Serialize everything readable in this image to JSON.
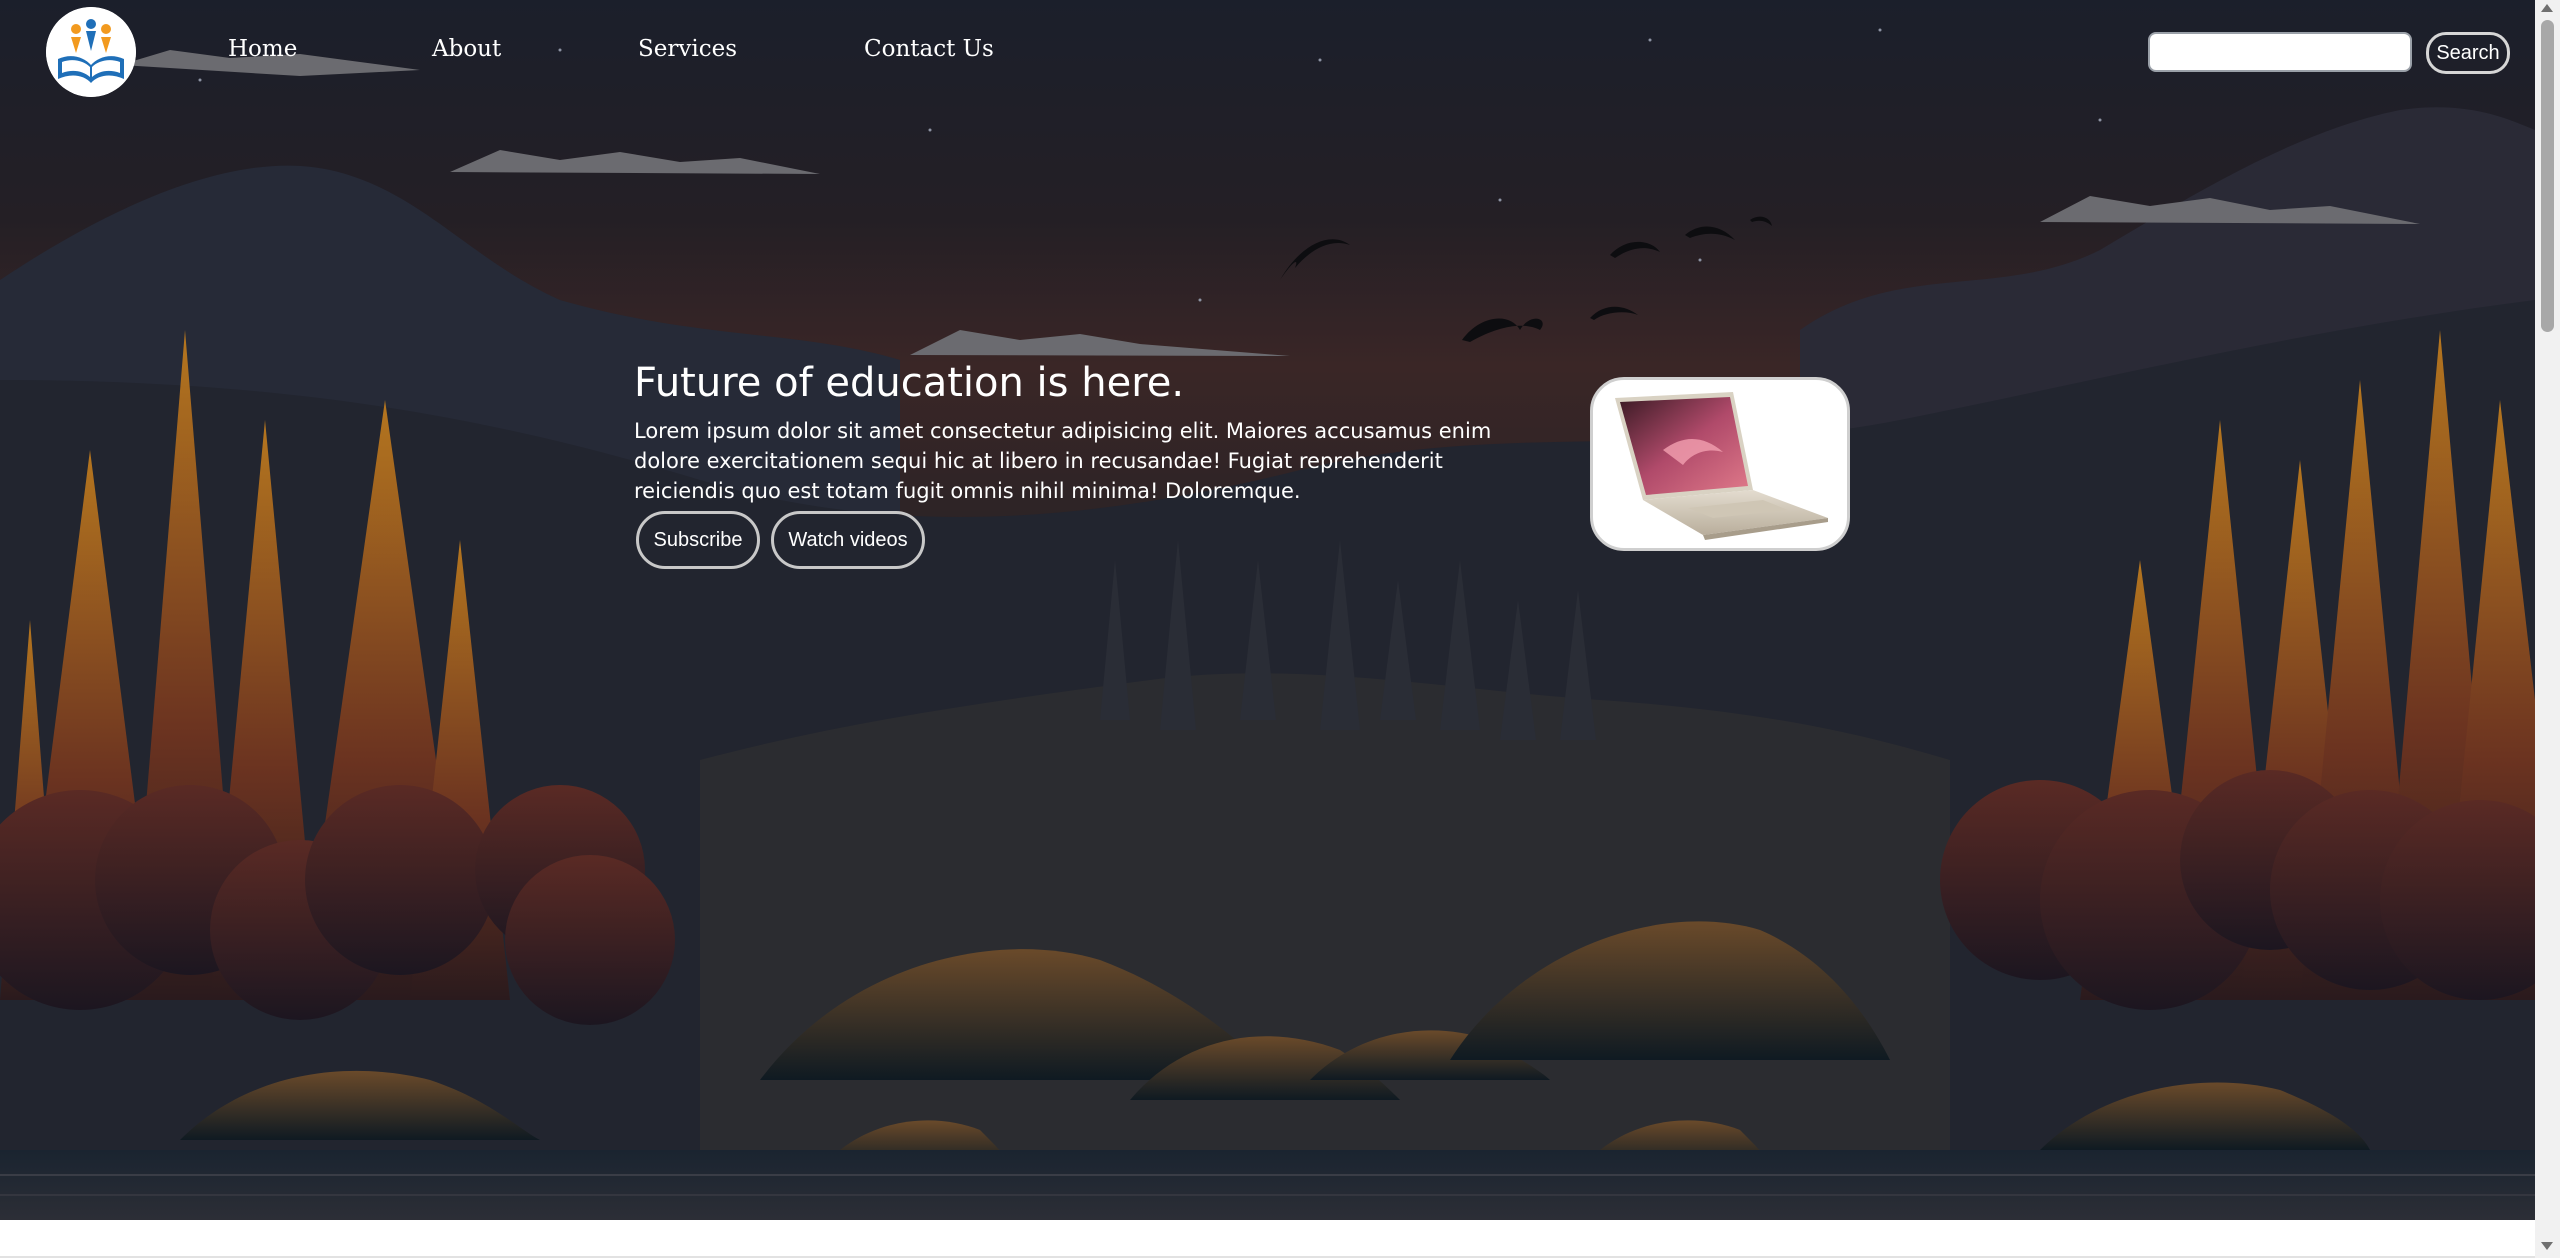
{
  "nav": {
    "home": "Home",
    "about": "About",
    "services": "Services",
    "contact": "Contact Us"
  },
  "search": {
    "placeholder": "",
    "button_label": "Search"
  },
  "hero": {
    "heading": "Future of education is here.",
    "text": "Lorem ipsum dolor sit amet consectetur adipisicing elit. Maiores accusamus enim dolore exercitationem sequi hic at libero in recusandae! Fugiat reprehenderit reiciendis quo est totam fugit omnis nihil minima! Doloremque.",
    "subscribe_label": "Subscribe",
    "watch_label": "Watch videos"
  },
  "icons": {
    "logo": "education-book-logo-icon",
    "product": "laptop-icon",
    "chat": "chat-bubble-icon"
  },
  "colors": {
    "accent_logo_blue": "#1f6fb8",
    "accent_logo_orange": "#f29a1f",
    "sky_top": "#1b1f2b",
    "sky_glow": "#3a2626",
    "tree_orange": "#a0661e"
  }
}
